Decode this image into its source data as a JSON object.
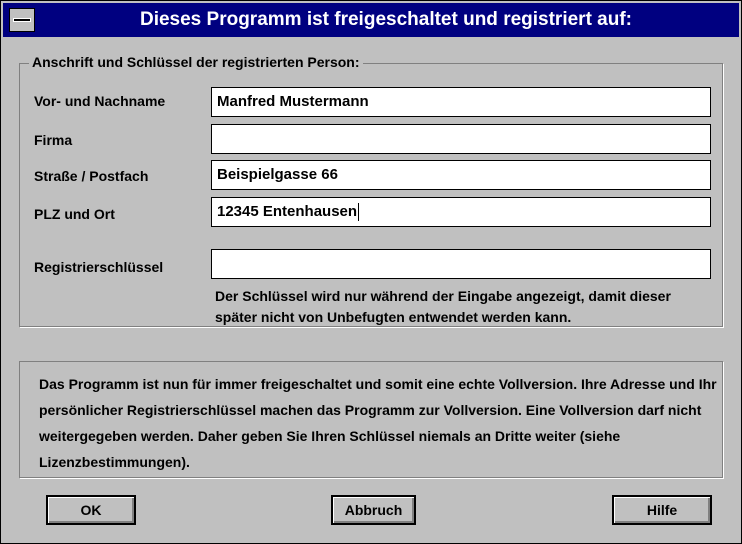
{
  "window": {
    "title": "Dieses Programm ist freigeschaltet und registriert auf:"
  },
  "group": {
    "label": "Anschrift und Schlüssel der registrierten Person:"
  },
  "fields": {
    "name": {
      "label": "Vor- und Nachname",
      "value": "Manfred Mustermann"
    },
    "firma": {
      "label": "Firma",
      "value": ""
    },
    "strasse": {
      "label": "Straße / Postfach",
      "value": "Beispielgasse 66"
    },
    "plz": {
      "label": "PLZ und Ort",
      "value": "12345 Entenhausen"
    },
    "schluessel": {
      "label": "Registrierschlüssel",
      "value": ""
    }
  },
  "hint": "Der Schlüssel wird nur während der Eingabe angezeigt, damit dieser später nicht von Unbefugten entwendet werden kann.",
  "info": "Das Programm ist nun für immer freigeschaltet und somit eine echte Vollversion. Ihre Adresse und Ihr persönlicher Registrierschlüssel machen das Programm zur Vollversion. Eine Vollversion darf nicht weitergegeben werden. Daher geben Sie Ihren Schlüssel niemals an Dritte weiter (siehe Lizenzbestimmungen).",
  "buttons": {
    "ok": "OK",
    "cancel": "Abbruch",
    "help": "Hilfe"
  },
  "colors": {
    "titlebar": "#000080",
    "face": "#c0c0c0"
  }
}
